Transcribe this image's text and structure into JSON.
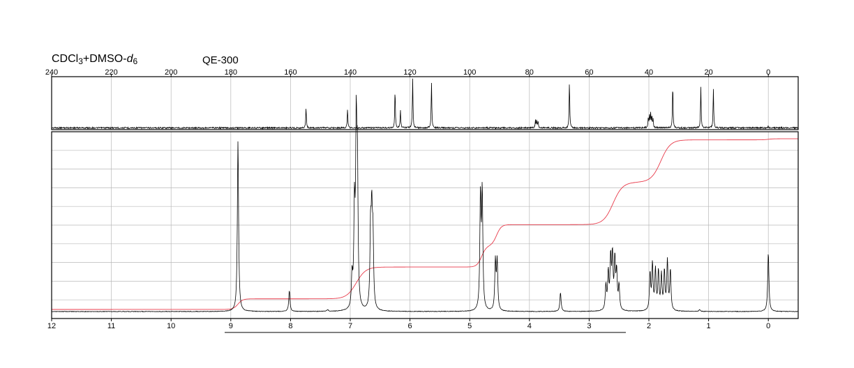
{
  "header": {
    "solvent_prefix": "CDCl",
    "solvent_sub1": "3",
    "solvent_mid": "+DMSO-",
    "solvent_italic": "d",
    "solvent_sub2": "6",
    "instrument": "QE-300"
  },
  "chart_data": [
    {
      "type": "line",
      "nucleus": "13C",
      "xlim": [
        240,
        -10
      ],
      "x_reversed": true,
      "x_ticks": [
        "240",
        "220",
        "200",
        "180",
        "160",
        "140",
        "120",
        "100",
        "80",
        "60",
        "40",
        "20",
        "0"
      ],
      "x_tick_values": [
        240,
        220,
        200,
        180,
        160,
        140,
        120,
        100,
        80,
        60,
        40,
        20,
        0
      ],
      "grid": true,
      "peaks": [
        {
          "ppm": 154.8,
          "height": 0.42
        },
        {
          "ppm": 140.9,
          "height": 0.38
        },
        {
          "ppm": 125.0,
          "height": 0.78
        },
        {
          "ppm": 123.2,
          "height": 0.36
        },
        {
          "ppm": 119.1,
          "height": 1.0
        },
        {
          "ppm": 112.8,
          "height": 0.93
        },
        {
          "ppm": 78.0,
          "height": 0.15
        },
        {
          "ppm": 77.6,
          "height": 0.16
        },
        {
          "ppm": 77.1,
          "height": 0.15
        },
        {
          "ppm": 66.6,
          "height": 0.94
        },
        {
          "ppm": 40.2,
          "height": 0.2
        },
        {
          "ppm": 39.8,
          "height": 0.26
        },
        {
          "ppm": 39.4,
          "height": 0.27
        },
        {
          "ppm": 39.0,
          "height": 0.22
        },
        {
          "ppm": 38.6,
          "height": 0.16
        },
        {
          "ppm": 32.0,
          "height": 0.88
        },
        {
          "ppm": 22.6,
          "height": 0.84
        },
        {
          "ppm": 18.4,
          "height": 0.79
        },
        {
          "ppm": 0.0,
          "height": 0.04
        }
      ]
    },
    {
      "type": "line",
      "nucleus": "1H",
      "xlim": [
        12,
        -0.5
      ],
      "x_reversed": true,
      "x_ticks": [
        "12",
        "11",
        "10",
        "9",
        "8",
        "7",
        "6",
        "5",
        "4",
        "3",
        "2",
        "1",
        "0"
      ],
      "x_tick_values": [
        12,
        11,
        10,
        9,
        8,
        7,
        6,
        5,
        4,
        3,
        2,
        1,
        0
      ],
      "grid": true,
      "peaks": [
        {
          "ppm": 8.88,
          "height": 0.98
        },
        {
          "ppm": 8.02,
          "height": 0.12
        },
        {
          "ppm": 7.38,
          "height": 0.01
        },
        {
          "ppm": 6.97,
          "height": 0.18
        },
        {
          "ppm": 6.93,
          "height": 0.55
        },
        {
          "ppm": 6.9,
          "height": 0.97
        },
        {
          "ppm": 6.88,
          "height": 0.75
        },
        {
          "ppm": 6.66,
          "height": 0.43
        },
        {
          "ppm": 6.64,
          "height": 0.49
        },
        {
          "ppm": 6.62,
          "height": 0.39
        },
        {
          "ppm": 4.82,
          "height": 0.64
        },
        {
          "ppm": 4.79,
          "height": 0.66
        },
        {
          "ppm": 4.57,
          "height": 0.28
        },
        {
          "ppm": 4.54,
          "height": 0.28
        },
        {
          "ppm": 3.48,
          "height": 0.11
        },
        {
          "ppm": 2.72,
          "height": 0.14
        },
        {
          "ppm": 2.68,
          "height": 0.21
        },
        {
          "ppm": 2.64,
          "height": 0.29
        },
        {
          "ppm": 2.61,
          "height": 0.3
        },
        {
          "ppm": 2.57,
          "height": 0.28
        },
        {
          "ppm": 2.54,
          "height": 0.21
        },
        {
          "ppm": 2.5,
          "height": 0.14
        },
        {
          "ppm": 1.98,
          "height": 0.21
        },
        {
          "ppm": 1.94,
          "height": 0.26
        },
        {
          "ppm": 1.89,
          "height": 0.23
        },
        {
          "ppm": 1.84,
          "height": 0.22
        },
        {
          "ppm": 1.79,
          "height": 0.2
        },
        {
          "ppm": 1.74,
          "height": 0.22
        },
        {
          "ppm": 1.69,
          "height": 0.28
        },
        {
          "ppm": 1.64,
          "height": 0.23
        },
        {
          "ppm": 1.15,
          "height": 0.01
        },
        {
          "ppm": 0.0,
          "height": 0.34
        }
      ],
      "integral_steps": [
        {
          "ppm": 8.88,
          "value": 1.0
        },
        {
          "ppm": 6.9,
          "value": 3.0
        },
        {
          "ppm": 4.8,
          "value": 2.0
        },
        {
          "ppm": 4.55,
          "value": 2.0
        },
        {
          "ppm": 2.6,
          "value": 4.0
        },
        {
          "ppm": 1.8,
          "value": 4.0
        },
        {
          "ppm": 0.0,
          "value": 0.1
        }
      ]
    }
  ],
  "colors": {
    "trace": "#000000",
    "integral": "#e83a4a",
    "grid": "#b8b8b8",
    "frame": "#000000"
  }
}
